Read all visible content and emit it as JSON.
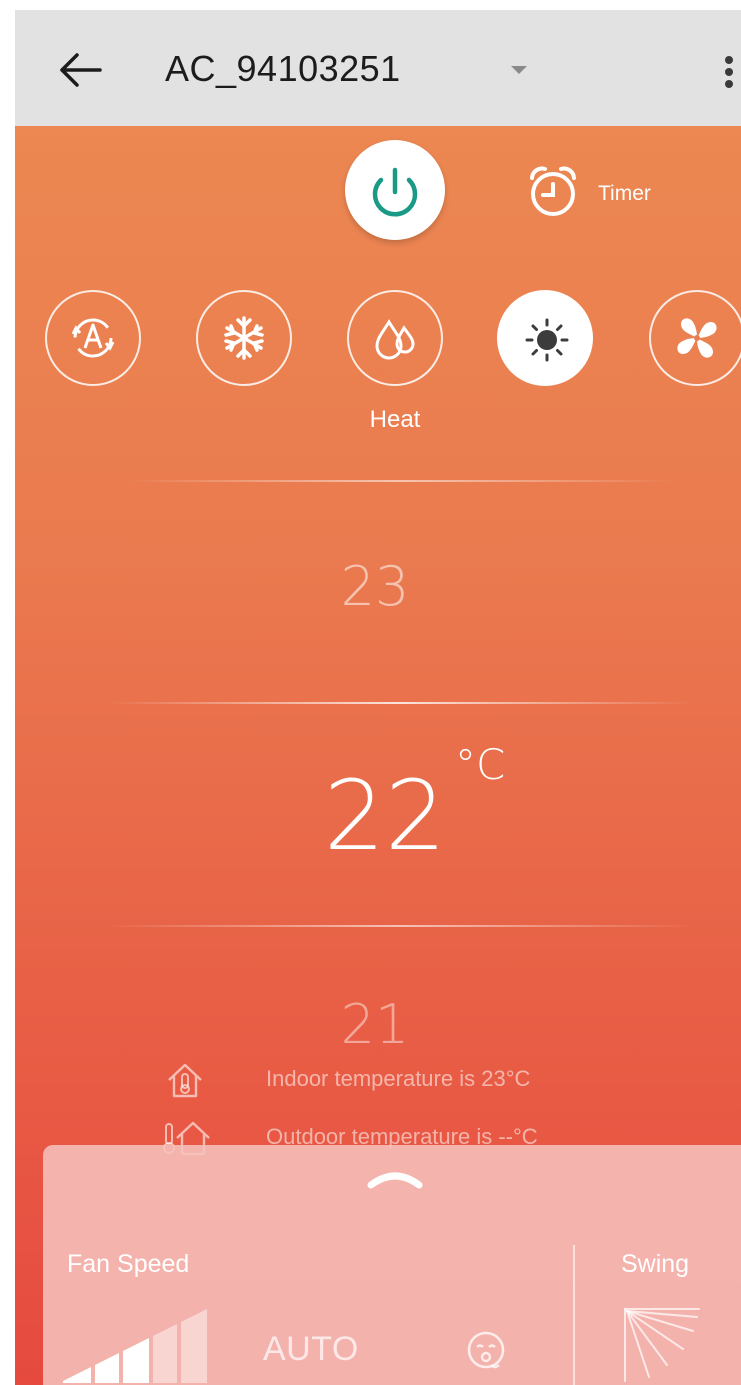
{
  "app": {
    "title": "AC_94103251"
  },
  "icons": {
    "back": "arrow-left-icon",
    "dropdown": "chevron-down-icon",
    "more": "more-vertical-icon",
    "power": "power-icon",
    "timer": "alarm-clock-icon",
    "auto_mode": "auto-mode-icon",
    "cool_mode": "snowflake-icon",
    "dry_mode": "water-drops-icon",
    "heat_mode": "sun-icon",
    "fan_mode": "fan-icon",
    "indoor": "house-thermometer-icon",
    "outdoor": "thermometer-house-icon",
    "expand": "chevron-up-icon",
    "fan_speed": "signal-bars-icon",
    "eco": "eco-face-icon",
    "swing": "swing-rays-icon"
  },
  "colors": {
    "accent": "#1a9a86",
    "gradient_top": "#ec8b52",
    "gradient_bottom": "#e64a3f",
    "appbar": "#e2e2e2"
  },
  "controls": {
    "timer_label": "Timer"
  },
  "mode": {
    "selected_label": "Heat",
    "options": [
      "auto",
      "cool",
      "dry",
      "heat",
      "fan"
    ],
    "selected": "heat"
  },
  "temperature": {
    "above": "23",
    "current": "22",
    "below": "21",
    "unit": "°C"
  },
  "info": {
    "indoor": "Indoor temperature is  23°C",
    "outdoor": "Outdoor temperature is  --°C"
  },
  "panel": {
    "fan_speed_label": "Fan Speed",
    "fan_speed_value": "AUTO",
    "swing_label": "Swing"
  }
}
